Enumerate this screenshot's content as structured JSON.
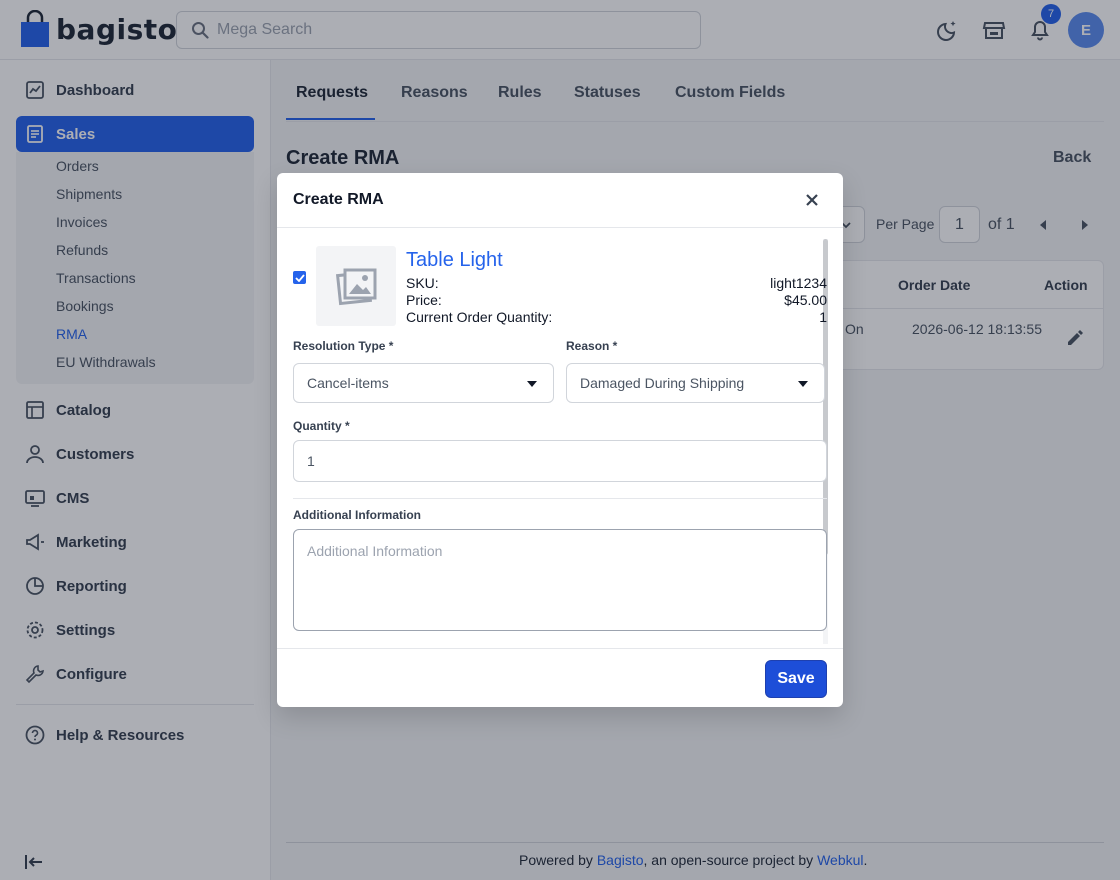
{
  "header": {
    "logo_text": "bagisto",
    "search_placeholder": "Mega Search",
    "notification_count": "7",
    "avatar_initial": "E"
  },
  "sidebar": {
    "items": [
      {
        "label": "Dashboard",
        "icon": "dashboard-icon"
      },
      {
        "label": "Sales",
        "icon": "sales-icon"
      },
      {
        "label": "Catalog",
        "icon": "catalog-icon"
      },
      {
        "label": "Customers",
        "icon": "customers-icon"
      },
      {
        "label": "CMS",
        "icon": "cms-icon"
      },
      {
        "label": "Marketing",
        "icon": "marketing-icon"
      },
      {
        "label": "Reporting",
        "icon": "reporting-icon"
      },
      {
        "label": "Settings",
        "icon": "settings-icon"
      },
      {
        "label": "Configure",
        "icon": "configure-icon"
      },
      {
        "label": "Help & Resources",
        "icon": "help-icon"
      }
    ],
    "sales_sub": [
      "Orders",
      "Shipments",
      "Invoices",
      "Refunds",
      "Transactions",
      "Bookings",
      "RMA",
      "EU Withdrawals"
    ]
  },
  "tabs": [
    "Requests",
    "Reasons",
    "Rules",
    "Statuses",
    "Custom Fields"
  ],
  "page": {
    "title": "Create RMA",
    "back_label": "Back",
    "per_page_label": "Per Page",
    "page_number": "1",
    "of_total": "of 1"
  },
  "table": {
    "headers": {
      "order_date": "Order Date",
      "action": "Action"
    },
    "row": {
      "partial_text": "On",
      "order_date": "2026-06-12 18:13:55"
    }
  },
  "modal": {
    "title": "Create RMA",
    "product": {
      "name": "Table Light",
      "sku_label": "SKU:",
      "sku": "light1234",
      "price_label": "Price:",
      "price": "$45.00",
      "qty_label": "Current Order Quantity:",
      "qty": "1"
    },
    "resolution_label": "Resolution Type *",
    "resolution_value": "Cancel-items",
    "reason_label": "Reason *",
    "reason_value": "Damaged During Shipping",
    "quantity_label": "Quantity *",
    "quantity_value": "1",
    "additional_label": "Additional Information",
    "additional_placeholder": "Additional Information",
    "save_label": "Save"
  },
  "footer": {
    "prefix": "Powered by ",
    "bagisto_link": "Bagisto",
    "middle": ", an open-source project by ",
    "webkul_link": "Webkul",
    "suffix": "."
  },
  "colors": {
    "accent": "#2563eb",
    "save": "#1d4ed8"
  }
}
